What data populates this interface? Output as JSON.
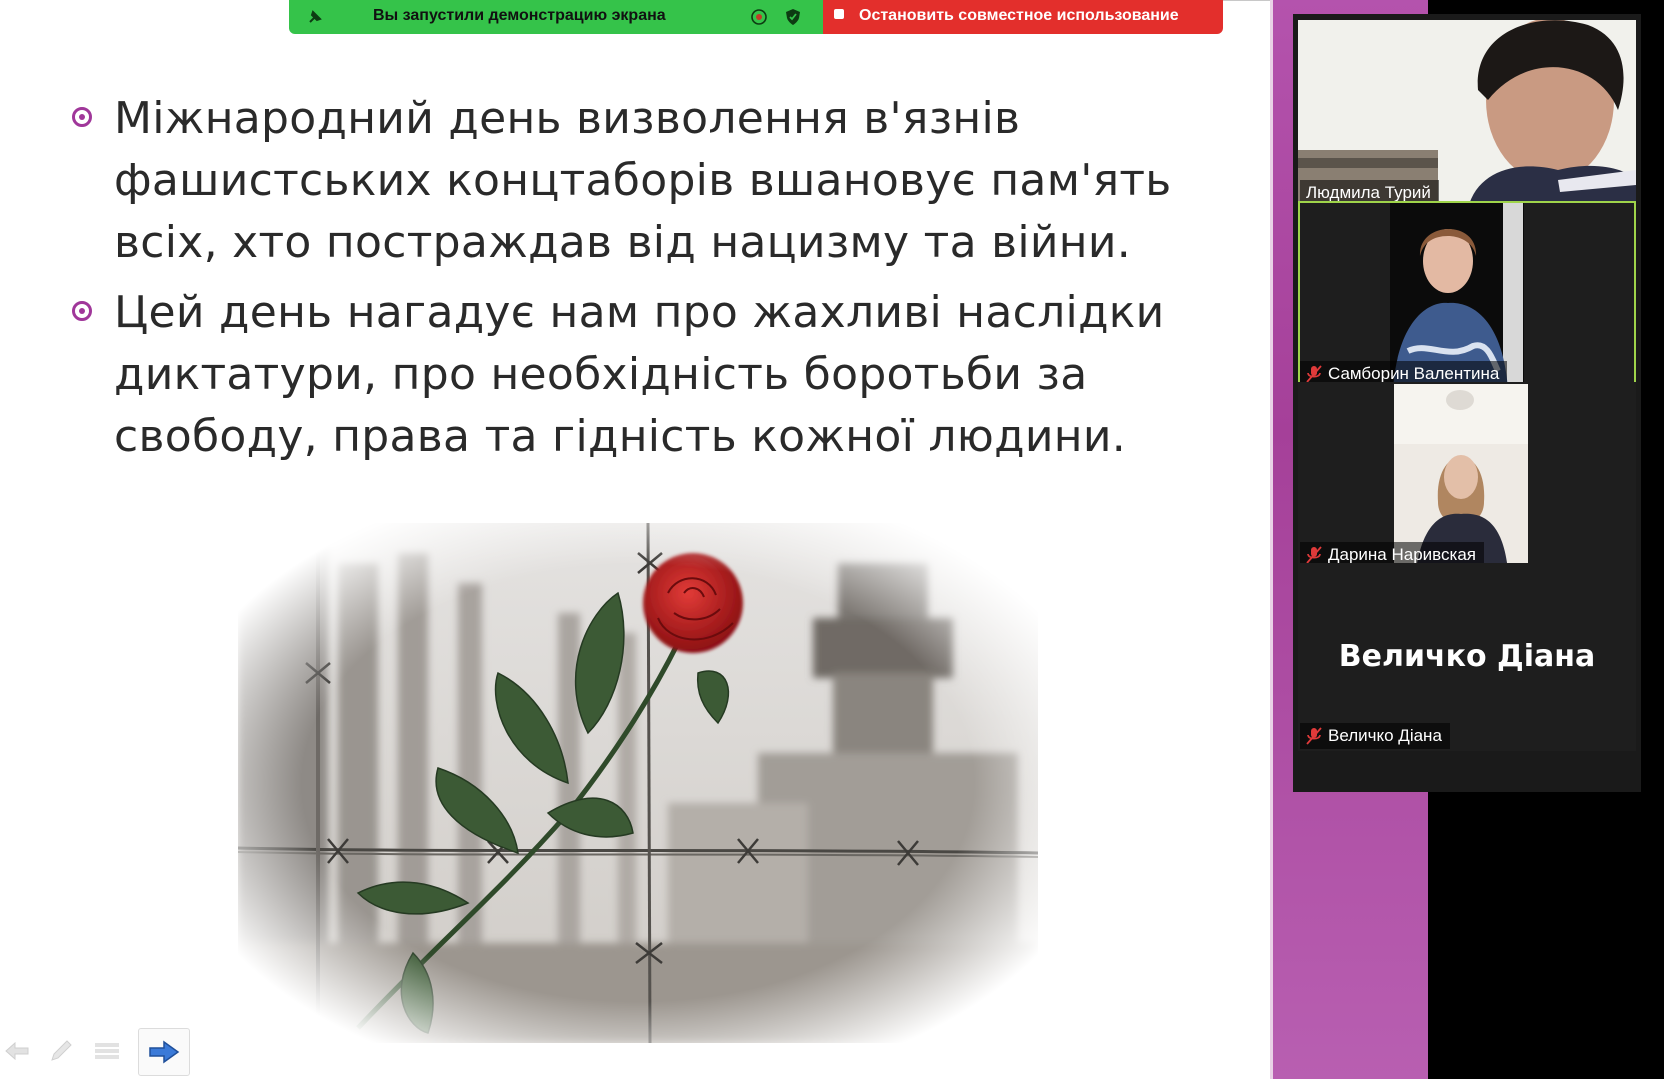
{
  "share_banner": {
    "status_text": "Вы запустили демонстрацию экрана",
    "stop_label": "Остановить совместное использование",
    "colors": {
      "green": "#35c34a",
      "red": "#e32f2c"
    }
  },
  "slide": {
    "bullets": [
      {
        "text": "Міжнародний день визволення в'язнів фашистських концтаборів вшановує пам'ять всіх, хто постраждав від нацизму та війни."
      },
      {
        "text": "Цей день нагадує нам про жахливі наслідки диктатури, про необхідність боротьби за свободу, права та гідність кожної людини."
      }
    ],
    "bullet_color": "#a0379a",
    "nav_icons": [
      "back-arrow-icon",
      "pen-icon",
      "menu-icon",
      "next-arrow-icon"
    ]
  },
  "participants": [
    {
      "name": "Людмила Турий",
      "muted": false,
      "video": true,
      "active": false
    },
    {
      "name": "Самборин Валентина",
      "muted": true,
      "video": true,
      "active": true
    },
    {
      "name": "Дарина Наривская",
      "muted": true,
      "video": true,
      "active": false
    },
    {
      "name": "Величко Діана",
      "muted": true,
      "video": false,
      "active": false,
      "display_name": "Величко Діана"
    }
  ],
  "colors": {
    "active_speaker_border": "#9fd44a",
    "sidebar_purple": "#a54099"
  }
}
